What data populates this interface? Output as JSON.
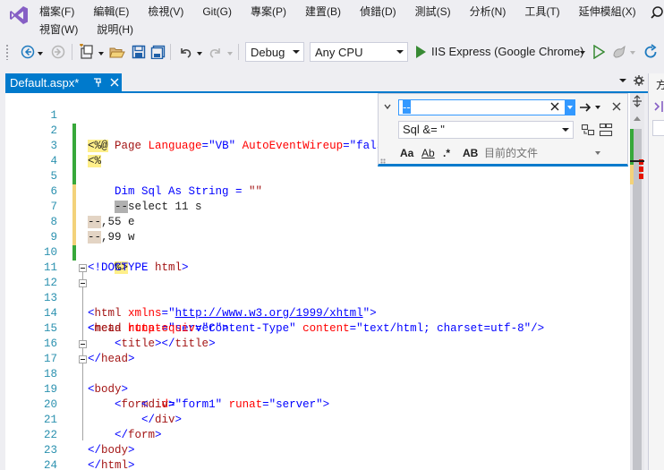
{
  "menu": {
    "row1": [
      "檔案(F)",
      "編輯(E)",
      "檢視(V)",
      "Git(G)",
      "專案(P)",
      "建置(B)",
      "偵錯(D)",
      "測試(S)",
      "分析(N)",
      "工具(T)",
      "延伸模組(X)"
    ],
    "row2": [
      "視窗(W)",
      "說明(H)"
    ]
  },
  "toolbar": {
    "configuration": "Debug",
    "platform": "Any CPU",
    "run_target": "IIS Express (Google Chrome)"
  },
  "tab": {
    "name": "Default.aspx*"
  },
  "find": {
    "search_value": "--",
    "replace_value": "Sql &= \"",
    "scope": "目前的文件",
    "option_labels": [
      "Aa",
      "Ab",
      ".*",
      "AB"
    ]
  },
  "right_panel": {
    "title_char": "方"
  },
  "editor": {
    "line_numbers": [
      "1",
      "2",
      "3",
      "4",
      "5",
      "6",
      "7",
      "8",
      "9",
      "10",
      "11",
      "12",
      "13",
      "14",
      "15",
      "16",
      "17",
      "18",
      "19",
      "20",
      "21",
      "22",
      "23",
      "24"
    ]
  },
  "code": {
    "l1": [
      "<%@",
      " Page",
      " Language",
      "=",
      "\"VB\"",
      " AutoEventWireup",
      "=",
      "\"false\""
    ],
    "l2": [
      "<%"
    ],
    "l4": [
      "    Dim Sql As String = ",
      "\"\""
    ],
    "l5": [
      "    ",
      "--",
      "select 11 s"
    ],
    "l6": [
      "--",
      ",55 e"
    ],
    "l7": [
      "--",
      ",99 w"
    ],
    "l9": [
      "    ",
      "%>"
    ],
    "l10": [
      "<!DOCTYPE ",
      "html",
      ">"
    ],
    "l12": [
      "<",
      "html",
      " xmlns",
      "=",
      "\"",
      "http://www.w3.org/1999/xhtml",
      "\"",
      ">"
    ],
    "l13": [
      "<",
      "head",
      " runat",
      "=",
      "\"server\"",
      ">"
    ],
    "l14": [
      "<",
      "meta",
      " http-equiv",
      "=",
      "\"Content-Type\"",
      " content",
      "=",
      "\"text/html; charset=utf-8\"",
      "/>"
    ],
    "l15": [
      "    <",
      "title",
      "></",
      "title",
      ">"
    ],
    "l16": [
      "</",
      "head",
      ">"
    ],
    "l17": [
      "<",
      "body",
      ">"
    ],
    "l18": [
      "    <",
      "form",
      " id",
      "=",
      "\"form1\"",
      " runat",
      "=",
      "\"server\"",
      ">"
    ],
    "l19": [
      "        <",
      "div",
      ">"
    ],
    "l20": [
      "        </",
      "div",
      ">"
    ],
    "l21": [
      "    </",
      "form",
      ">"
    ],
    "l22": [
      "</",
      "body",
      ">"
    ],
    "l23": [
      "</",
      "html",
      ">"
    ]
  },
  "colors": {
    "accent": "#007acc",
    "change_saved": "#37a83a",
    "change_unsaved": "#f3d27a",
    "keyword": "#0000ff",
    "tag": "#a31515",
    "attribute": "#ff0000",
    "line_number": "#2b91af"
  }
}
